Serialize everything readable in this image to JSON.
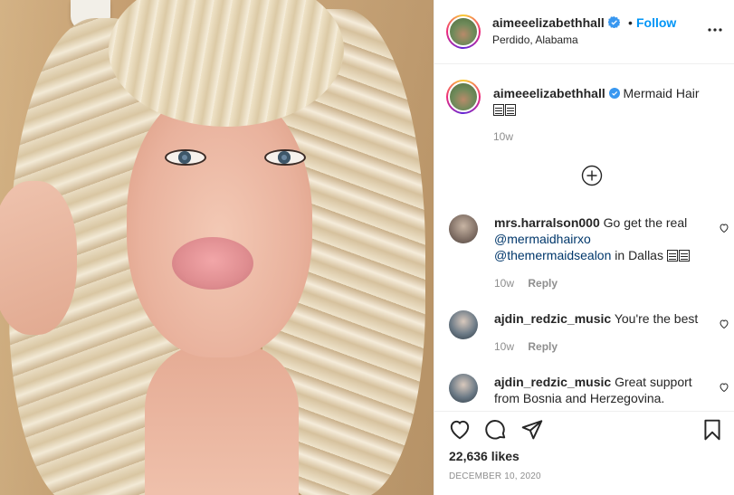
{
  "post": {
    "author": "aimeeelizabethhall",
    "location": "Perdido, Alabama",
    "follow_label": "Follow",
    "dot": "•",
    "likes": "22,636 likes",
    "date": "DECEMBER 10, 2020"
  },
  "caption": {
    "username": "aimeeelizabethhall",
    "text": "Mermaid Hair",
    "time": "10w"
  },
  "comments": [
    {
      "username": "mrs.harralson000",
      "text_before": "Go get the real",
      "mention1": "@mermaidhairxo",
      "mention2": "@themermaidsealon",
      "text_after": "in Dallas",
      "time": "10w",
      "reply_label": "Reply"
    },
    {
      "username": "ajdin_redzic_music",
      "text": "You're the best",
      "time": "10w",
      "reply_label": "Reply"
    },
    {
      "username": "ajdin_redzic_music",
      "text": "Great support from Bosnia and Herzegovina."
    }
  ],
  "colors": {
    "accent": "#0095f6",
    "verified": "#3897f0",
    "mention": "#00376b",
    "muted": "#8e8e8e"
  },
  "icons": {
    "more": "more-horizontal-icon",
    "verified": "verified-badge-icon",
    "load_more": "plus-circle-icon",
    "like": "heart-icon",
    "comment": "comment-icon",
    "share": "paper-plane-icon",
    "save": "bookmark-icon"
  }
}
